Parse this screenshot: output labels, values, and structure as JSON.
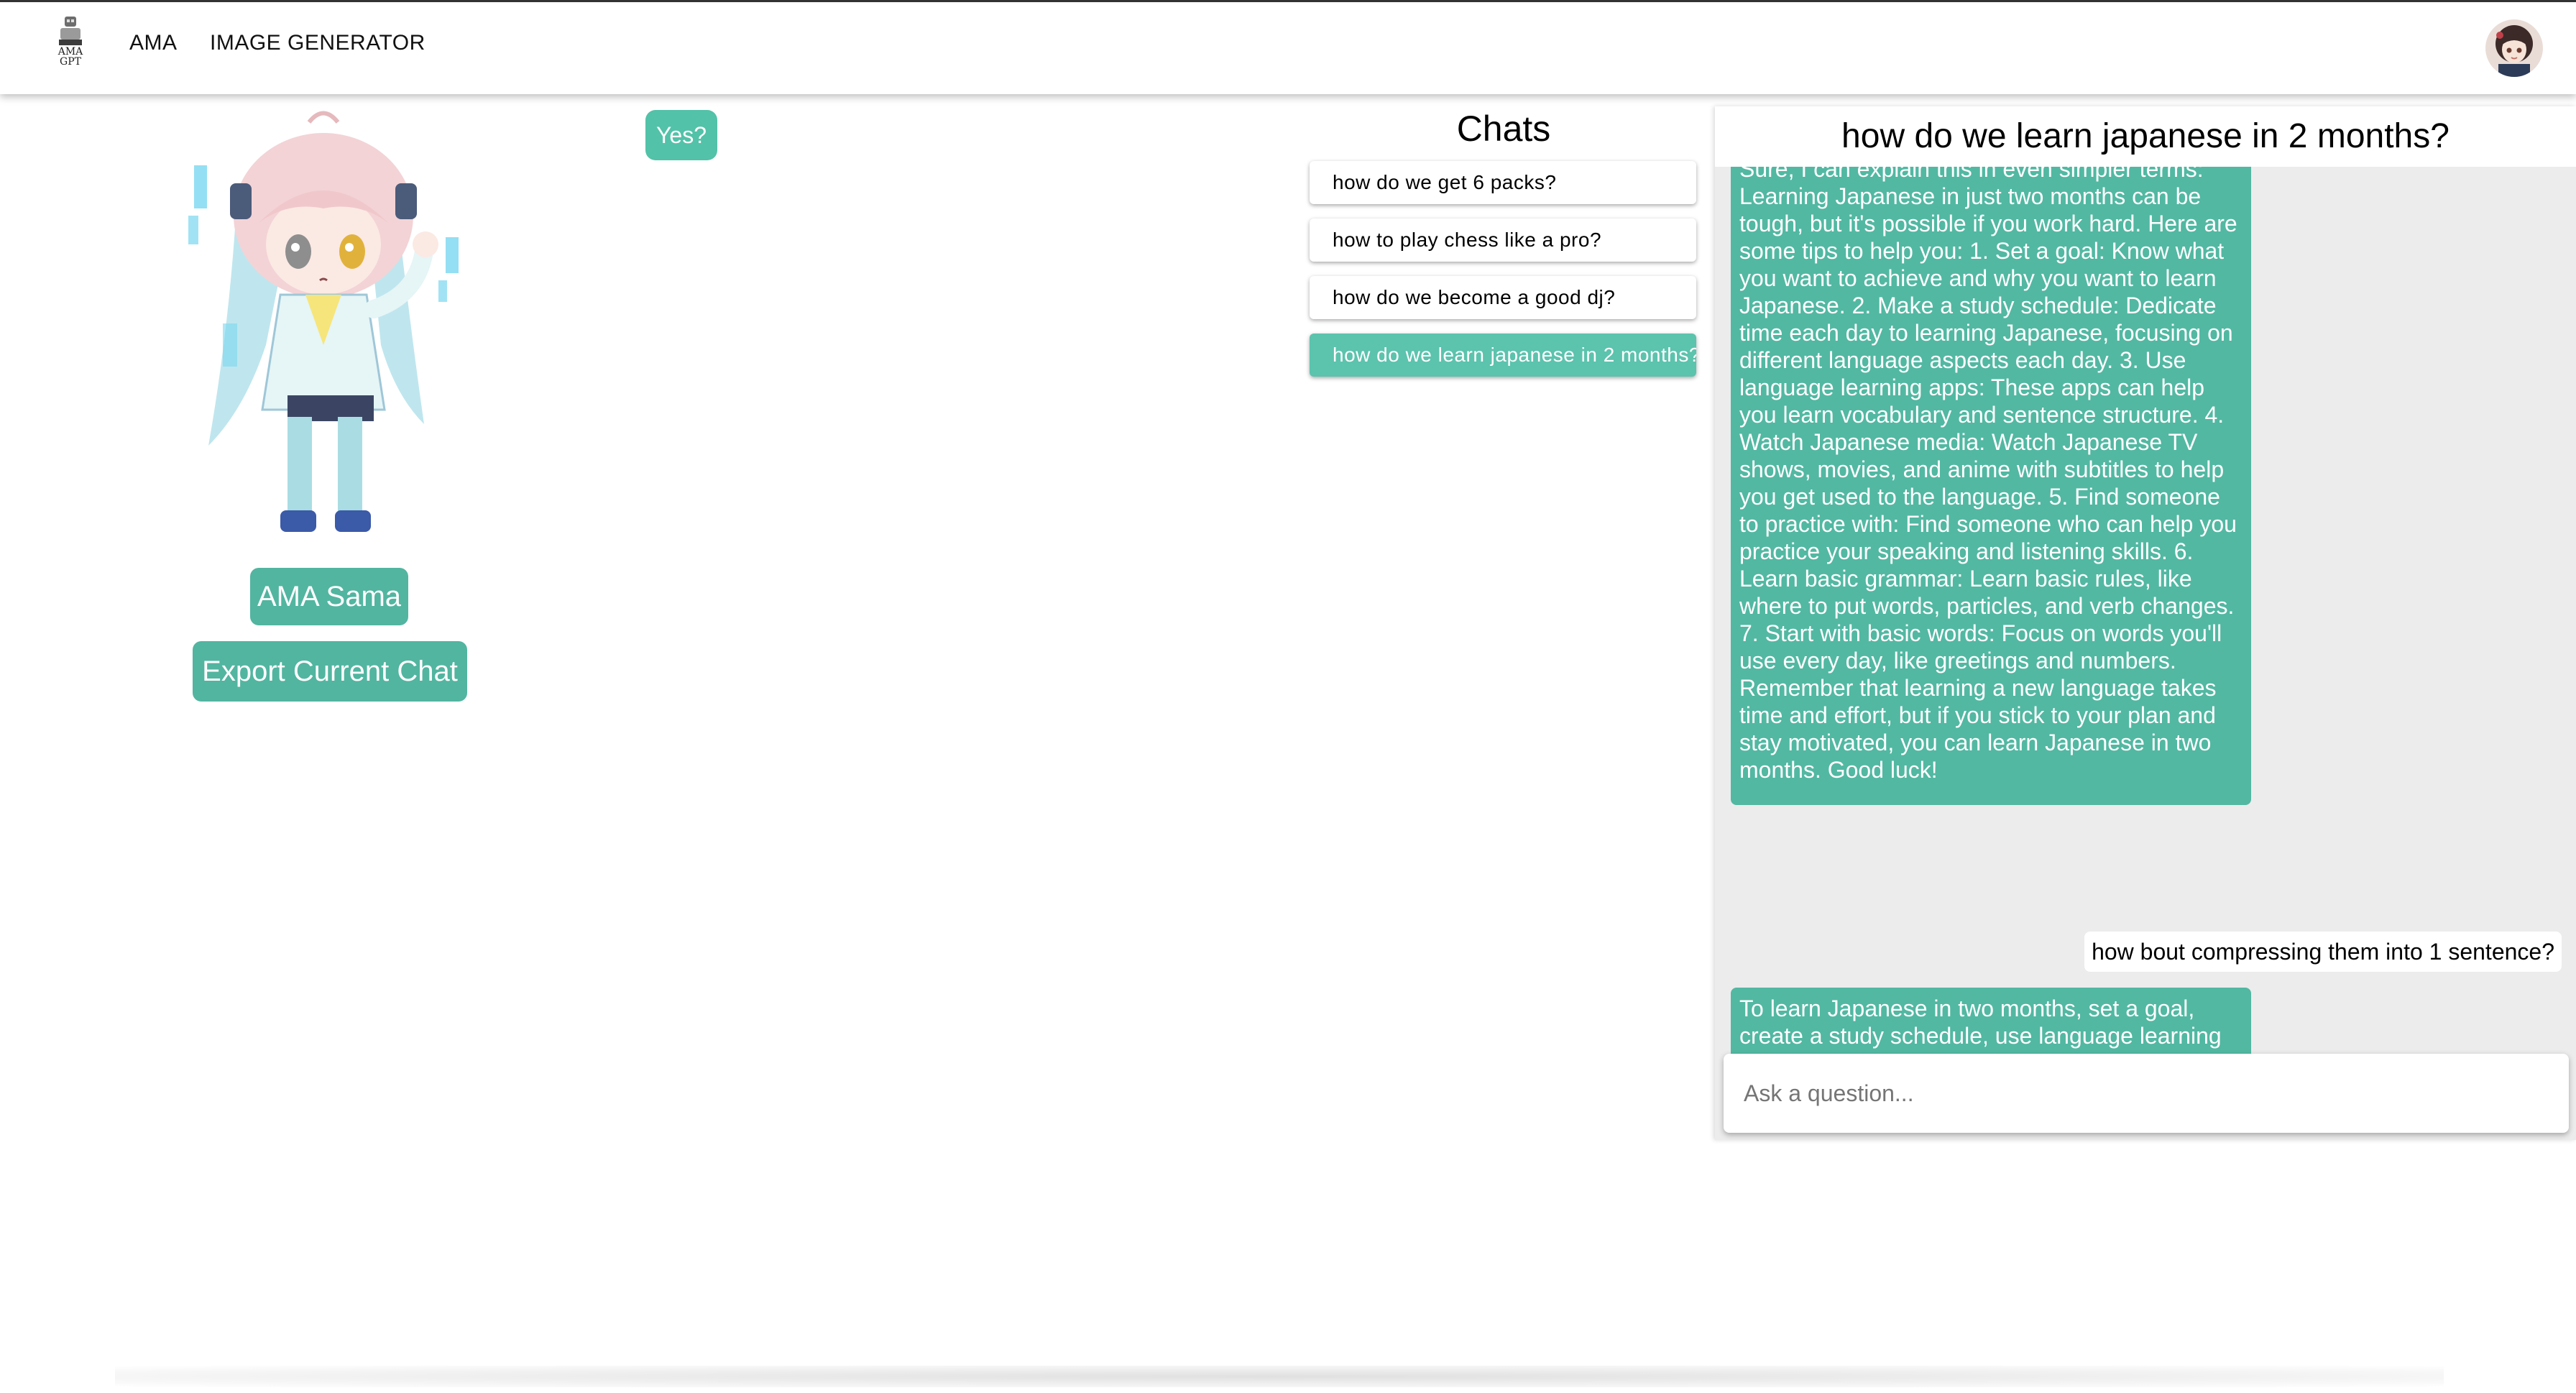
{
  "header": {
    "logo_text_line1": "AMA",
    "logo_text_line2": "GPT",
    "nav": [
      {
        "label": "AMA"
      },
      {
        "label": "IMAGE GENERATOR"
      }
    ]
  },
  "character": {
    "name_button": "AMA Sama",
    "export_button": "Export Current Chat",
    "speech_bubble": "Yes?"
  },
  "chats": {
    "title": "Chats",
    "items": [
      {
        "label": "how do we get 6 packs?",
        "active": false
      },
      {
        "label": "how to play chess like a pro?",
        "active": false
      },
      {
        "label": "how do we become a good dj?",
        "active": false
      },
      {
        "label": "how do we learn japanese in 2 months?",
        "active": true
      }
    ]
  },
  "conversation": {
    "title": "how do we learn japanese in 2 months?",
    "messages": [
      {
        "role": "bot",
        "text": "Sure, I can explain this in even simpler terms: Learning Japanese in just two months can be tough, but it's possible if you work hard. Here are some tips to help you: 1. Set a goal: Know what you want to achieve and why you want to learn Japanese. 2. Make a study schedule: Dedicate time each day to learning Japanese, focusing on different language aspects each day. 3. Use language learning apps: These apps can help you learn vocabulary and sentence structure. 4. Watch Japanese media: Watch Japanese TV shows, movies, and anime with subtitles to help you get used to the language. 5. Find someone to practice with: Find someone who can help you practice your speaking and listening skills. 6. Learn basic grammar: Learn basic rules, like where to put words, particles, and verb changes. 7. Start with basic words: Focus on words you'll use every day, like greetings and numbers. Remember that learning a new language takes time and effort, but if you stick to your plan and stay motivated, you can learn Japanese in two months. Good luck!"
      },
      {
        "role": "user",
        "text": "how bout compressing them into 1 sentence?"
      },
      {
        "role": "bot",
        "text": "To learn Japanese in two months, set a goal, create a study schedule, use language learning apps, watch Japanese media, find someone to practice with, learn basic grammar, and start with basic words."
      }
    ],
    "input_placeholder": "Ask a question..."
  },
  "colors": {
    "accent": "#52b5a0",
    "active_chat": "#5cc3ad",
    "panel_bg": "#ececec"
  }
}
